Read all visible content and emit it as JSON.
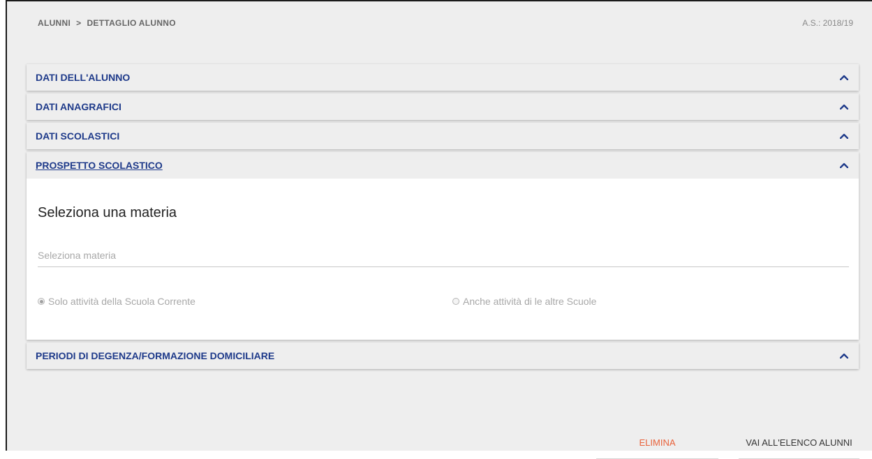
{
  "breadcrumb": {
    "root": "ALUNNI",
    "separator": ">",
    "current": "DETTAGLIO ALUNNO"
  },
  "school_year": "A.S.: 2018/19",
  "panels": [
    {
      "title": "DATI DELL'ALUNNO",
      "expanded": false
    },
    {
      "title": "DATI ANAGRAFICI",
      "expanded": false
    },
    {
      "title": "DATI SCOLASTICI",
      "expanded": false
    },
    {
      "title": "PROSPETTO SCOLASTICO",
      "expanded": true
    },
    {
      "title": "PERIODI DI DEGENZA/FORMAZIONE DOMICILIARE",
      "expanded": false
    }
  ],
  "prospetto": {
    "heading": "Seleziona una materia",
    "materia_placeholder": "Seleziona materia",
    "materia_value": "",
    "options": [
      {
        "label": "Solo attività della Scuola Corrente",
        "selected": true
      },
      {
        "label": "Anche attività di le altre Scuole",
        "selected": false
      }
    ]
  },
  "actions": {
    "delete_label": "ELIMINA",
    "back_label": "VAI ALL'ELENCO ALUNNI"
  },
  "colors": {
    "accent": "#1e3a8a",
    "danger": "#e8613a",
    "background": "#eeeeee"
  }
}
